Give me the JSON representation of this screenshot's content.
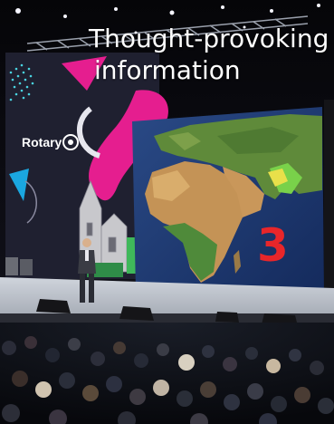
{
  "caption": {
    "line1": "Thought-provoking",
    "line2": "information"
  },
  "stage": {
    "logo_text": "Rotary",
    "screen_number": "3"
  },
  "colors": {
    "caption_text": "#ffffff",
    "number": "#e8262a",
    "magenta": "#e51e8f",
    "ocean": "#1e3a72"
  }
}
